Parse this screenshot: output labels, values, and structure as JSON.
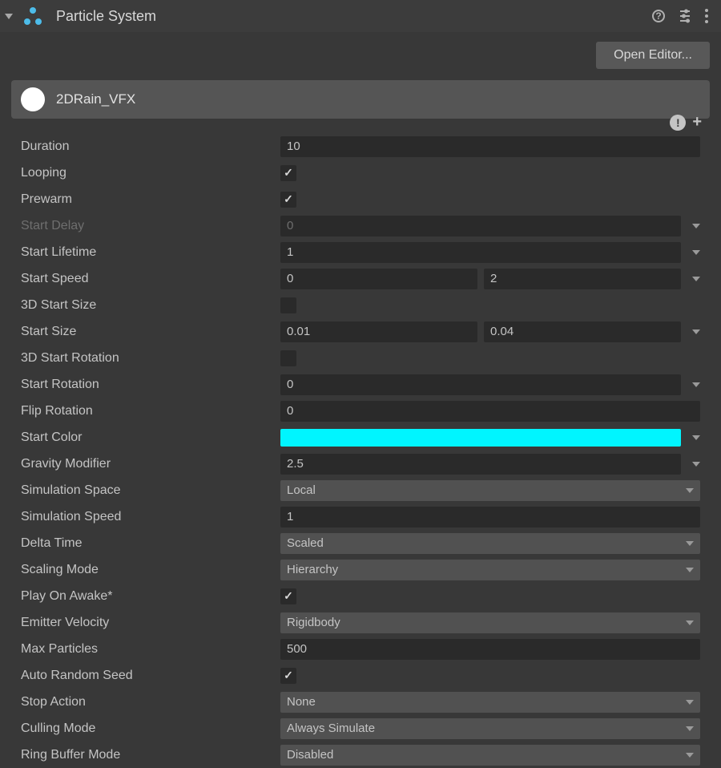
{
  "header": {
    "title": "Particle System",
    "open_editor": "Open Editor..."
  },
  "module": {
    "name": "2DRain_VFX"
  },
  "props": {
    "duration": {
      "label": "Duration",
      "value": "10"
    },
    "looping": {
      "label": "Looping"
    },
    "prewarm": {
      "label": "Prewarm"
    },
    "start_delay": {
      "label": "Start Delay",
      "value": "0"
    },
    "start_lifetime": {
      "label": "Start Lifetime",
      "value": "1"
    },
    "start_speed": {
      "label": "Start Speed",
      "a": "0",
      "b": "2"
    },
    "start_size_3d": {
      "label": "3D Start Size"
    },
    "start_size": {
      "label": "Start Size",
      "a": "0.01",
      "b": "0.04"
    },
    "start_rot_3d": {
      "label": "3D Start Rotation"
    },
    "start_rotation": {
      "label": "Start Rotation",
      "value": "0"
    },
    "flip_rotation": {
      "label": "Flip Rotation",
      "value": "0"
    },
    "start_color": {
      "label": "Start Color",
      "hex": "#00f5ff"
    },
    "gravity": {
      "label": "Gravity Modifier",
      "value": "2.5"
    },
    "sim_space": {
      "label": "Simulation Space",
      "value": "Local"
    },
    "sim_speed": {
      "label": "Simulation Speed",
      "value": "1"
    },
    "delta_time": {
      "label": "Delta Time",
      "value": "Scaled"
    },
    "scaling_mode": {
      "label": "Scaling Mode",
      "value": "Hierarchy"
    },
    "play_on_awake": {
      "label": "Play On Awake*"
    },
    "emitter_velocity": {
      "label": "Emitter Velocity",
      "value": "Rigidbody"
    },
    "max_particles": {
      "label": "Max Particles",
      "value": "500"
    },
    "auto_random_seed": {
      "label": "Auto Random Seed"
    },
    "stop_action": {
      "label": "Stop Action",
      "value": "None"
    },
    "culling_mode": {
      "label": "Culling Mode",
      "value": "Always Simulate"
    },
    "ring_buffer": {
      "label": "Ring Buffer Mode",
      "value": "Disabled"
    }
  }
}
